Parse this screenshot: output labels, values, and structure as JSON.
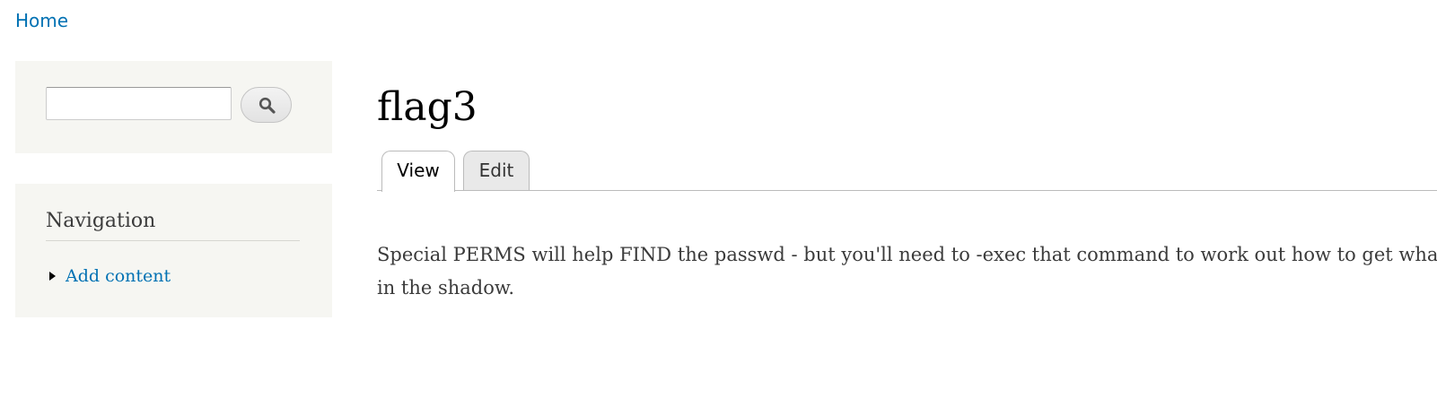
{
  "breadcrumb": {
    "home": "Home"
  },
  "search": {
    "value": "",
    "button_icon": "search-icon"
  },
  "navigation": {
    "title": "Navigation",
    "items": [
      {
        "label": "Add content"
      }
    ]
  },
  "page": {
    "title": "flag3",
    "tabs": [
      {
        "label": "View",
        "active": true
      },
      {
        "label": "Edit",
        "active": false
      }
    ],
    "body_line_1": "Special PERMS will help FIND the passwd - but you'll need to -exec that command to work out how to get what's",
    "body_line_2": "in the shadow."
  },
  "colors": {
    "link": "#0071b3",
    "sidebar_background": "#f6f6f2",
    "tab_inactive": "#e9e9e9"
  }
}
